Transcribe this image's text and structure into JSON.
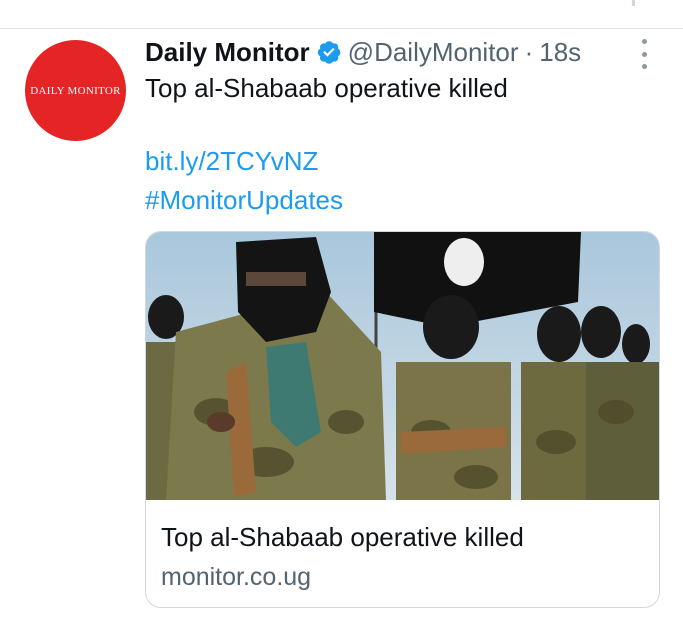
{
  "tweet": {
    "avatar_text": "DAILY MONITOR",
    "display_name": "Daily Monitor",
    "handle": "@DailyMonitor",
    "separator": "·",
    "timestamp": "18s",
    "text": "Top al-Shabaab operative killed",
    "link_url": "bit.ly/2TCYvNZ",
    "hashtag": "#MonitorUpdates"
  },
  "card": {
    "title": "Top al-Shabaab operative killed",
    "domain": "monitor.co.ug"
  },
  "colors": {
    "link": "#1d9bf0",
    "avatar_bg": "#e42425",
    "verified": "#1d9bf0",
    "secondary_text": "#536471"
  },
  "icons": {
    "verified": "verified-badge-icon",
    "more": "more-options-icon"
  }
}
